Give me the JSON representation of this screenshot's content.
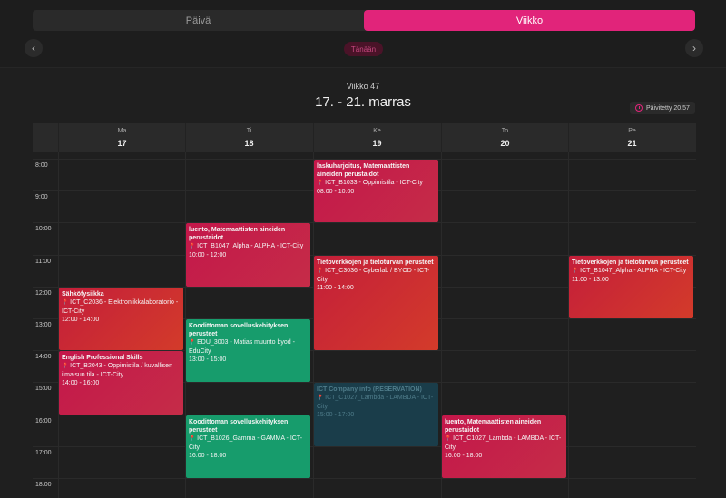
{
  "tabs": [
    {
      "label": "Päivä",
      "active": false
    },
    {
      "label": "Viikko",
      "active": true
    }
  ],
  "nav": {
    "prev_icon": "‹",
    "next_icon": "›",
    "today_label": "Tänään"
  },
  "header": {
    "week_label": "Viikko 47",
    "date_range": "17. - 21. marras",
    "updated_label": "Päivitetty 20.57"
  },
  "days": [
    {
      "name": "Ma",
      "num": "17"
    },
    {
      "name": "Ti",
      "num": "18"
    },
    {
      "name": "Ke",
      "num": "19"
    },
    {
      "name": "To",
      "num": "20"
    },
    {
      "name": "Pe",
      "num": "21"
    }
  ],
  "times": [
    "8:00",
    "9:00",
    "10:00",
    "11:00",
    "12:00",
    "13:00",
    "14:00",
    "15:00",
    "16:00",
    "17:00",
    "18:00"
  ],
  "events": [
    {
      "day": 2,
      "start": 8,
      "end": 10,
      "color": "pink",
      "title": "laskuharjoitus, Matemaattisten aineiden perustaidot",
      "location": "ICT_B1033 - Oppimistila - ICT-City",
      "time": "08:00 - 10:00"
    },
    {
      "day": 1,
      "start": 10,
      "end": 12,
      "color": "pink",
      "title": "luento, Matemaattisten aineiden perustaidot",
      "location": "ICT_B1047_Alpha - ALPHA - ICT-City",
      "time": "10:00 - 12:00"
    },
    {
      "day": 2,
      "start": 11,
      "end": 14,
      "color": "red",
      "title": "Tietoverkkojen ja tietoturvan perusteet",
      "location": "ICT_C3036 - Cyberlab / BYOD - ICT-City",
      "time": "11:00 - 14:00"
    },
    {
      "day": 4,
      "start": 11,
      "end": 13,
      "color": "red",
      "title": "Tietoverkkojen ja tietoturvan perusteet",
      "location": "ICT_B1047_Alpha - ALPHA - ICT-City",
      "time": "11:00 - 13:00"
    },
    {
      "day": 0,
      "start": 12,
      "end": 14,
      "color": "red",
      "title": "Sähköfysiikka",
      "location": "ICT_C2036 - Elektroniikkalaboratorio - ICT-City",
      "time": "12:00 - 14:00"
    },
    {
      "day": 1,
      "start": 13,
      "end": 15,
      "color": "green",
      "title": "Koodittoman sovelluskehityksen perusteet",
      "location": "EDU_3003 - Matias muunto byod - EduCity",
      "time": "13:00 - 15:00"
    },
    {
      "day": 0,
      "start": 14,
      "end": 16,
      "color": "pink",
      "title": "English Professional Skills",
      "location": "ICT_B2043 - Oppimistila / kuvallisen ilmaisun tila - ICT-City",
      "time": "14:00 - 16:00"
    },
    {
      "day": 2,
      "start": 15,
      "end": 17,
      "color": "teal",
      "title": "ICT Company info (RESERVATION)",
      "location": "ICT_C1027_Lambda - LAMBDA - ICT-City",
      "time": "15:00 - 17:00"
    },
    {
      "day": 3,
      "start": 16,
      "end": 18,
      "color": "pink",
      "title": "luento, Matemaattisten aineiden perustaidot",
      "location": "ICT_C1027_Lambda - LAMBDA - ICT-City",
      "time": "16:00 - 18:00"
    },
    {
      "day": 1,
      "start": 16,
      "end": 18,
      "color": "green",
      "title": "Koodittoman sovelluskehityksen perusteet",
      "location": "ICT_B1026_Gamma - GAMMA - ICT-City",
      "time": "16:00 - 18:00"
    }
  ]
}
